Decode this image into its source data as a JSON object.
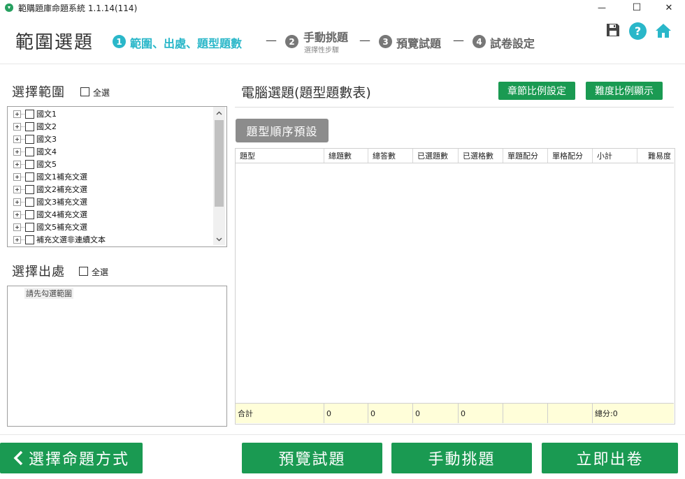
{
  "window": {
    "title": "範購題庫命題系統 1.1.14(114)",
    "minimize_glyph": "—",
    "maximize_glyph": "☐",
    "close_glyph": "✕"
  },
  "header": {
    "page_title": "範圍選題",
    "steps": [
      {
        "number": "1",
        "label": "範圍、出處、題型題數",
        "active": true
      },
      {
        "number": "2",
        "label": "手動挑題",
        "sublabel": "選擇性步驟",
        "active": false
      },
      {
        "number": "3",
        "label": "預覽試題",
        "active": false
      },
      {
        "number": "4",
        "label": "試卷設定",
        "active": false
      }
    ],
    "separator": "—",
    "icons": {
      "save": "save-icon",
      "help": "help-icon",
      "home": "home-icon"
    },
    "help_glyph": "?"
  },
  "colors": {
    "accent": "#2ab7c9",
    "green": "#1a9a52",
    "gray_step": "#777777",
    "footer_row": "#fffed9"
  },
  "range": {
    "title": "選擇範圍",
    "select_all": "全選",
    "items": [
      "國文1",
      "國文2",
      "國文3",
      "國文4",
      "國文5",
      "國文1補充文選",
      "國文2補充文選",
      "國文3補充文選",
      "國文4補充文選",
      "國文5補充文選",
      "補充文選非連續文本"
    ]
  },
  "source": {
    "title": "選擇出處",
    "select_all": "全選",
    "placeholder": "請先勾選範圍"
  },
  "main": {
    "title": "電腦選題(題型題數表)",
    "chapter_ratio_button": "章節比例設定",
    "difficulty_ratio_button": "難度比例顯示",
    "order_preset_button": "題型順序預設",
    "table": {
      "headers": [
        "題型",
        "總題數",
        "總答數",
        "已選題數",
        "已選格數",
        "單題配分",
        "單格配分",
        "小計",
        "難易度"
      ],
      "footer": [
        "合計",
        "0",
        "0",
        "0",
        "0",
        "",
        "",
        "總分:0",
        ""
      ]
    }
  },
  "footer": {
    "back_button": "選擇命題方式",
    "preview_button": "預覽試題",
    "manual_button": "手動挑題",
    "generate_button": "立即出卷"
  }
}
